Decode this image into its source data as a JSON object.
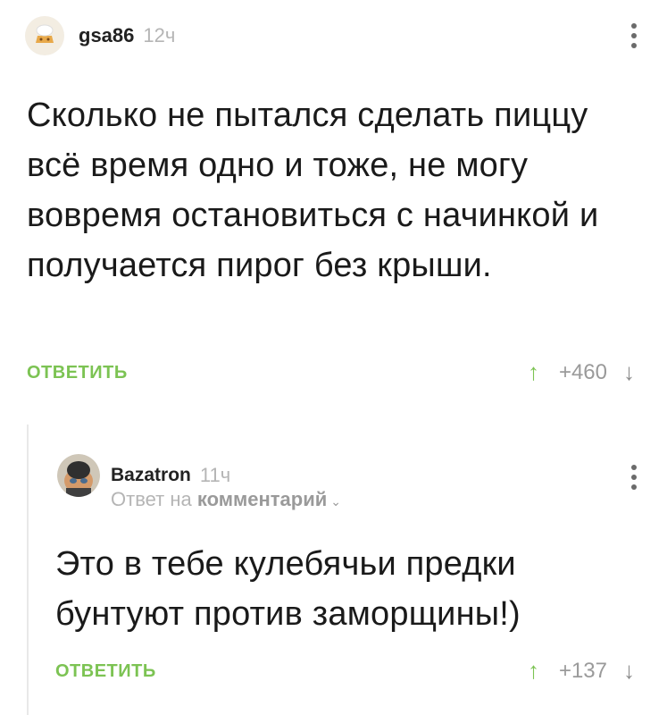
{
  "comment1": {
    "username": "gsa86",
    "time": "12ч",
    "text": "Сколько не пытался сделать пиццу всё время одно и тоже, не могу вовремя остановиться с начинкой и получается пирог без крыши.",
    "reply_label": "ОТВЕТИТЬ",
    "rating": "+460",
    "vote_up": "↑",
    "vote_down": "↓"
  },
  "comment2": {
    "username": "Bazatron",
    "time": "11ч",
    "reply_prefix": "Ответ на",
    "reply_link": "комментарий",
    "text": "Это в тебе кулебячьи предки бунтуют против заморщины!)",
    "reply_label": "ОТВЕТИТЬ",
    "rating": "+137",
    "vote_up": "↑",
    "vote_down": "↓"
  },
  "colors": {
    "accent": "#7cc353",
    "muted": "#b5b5b5"
  }
}
